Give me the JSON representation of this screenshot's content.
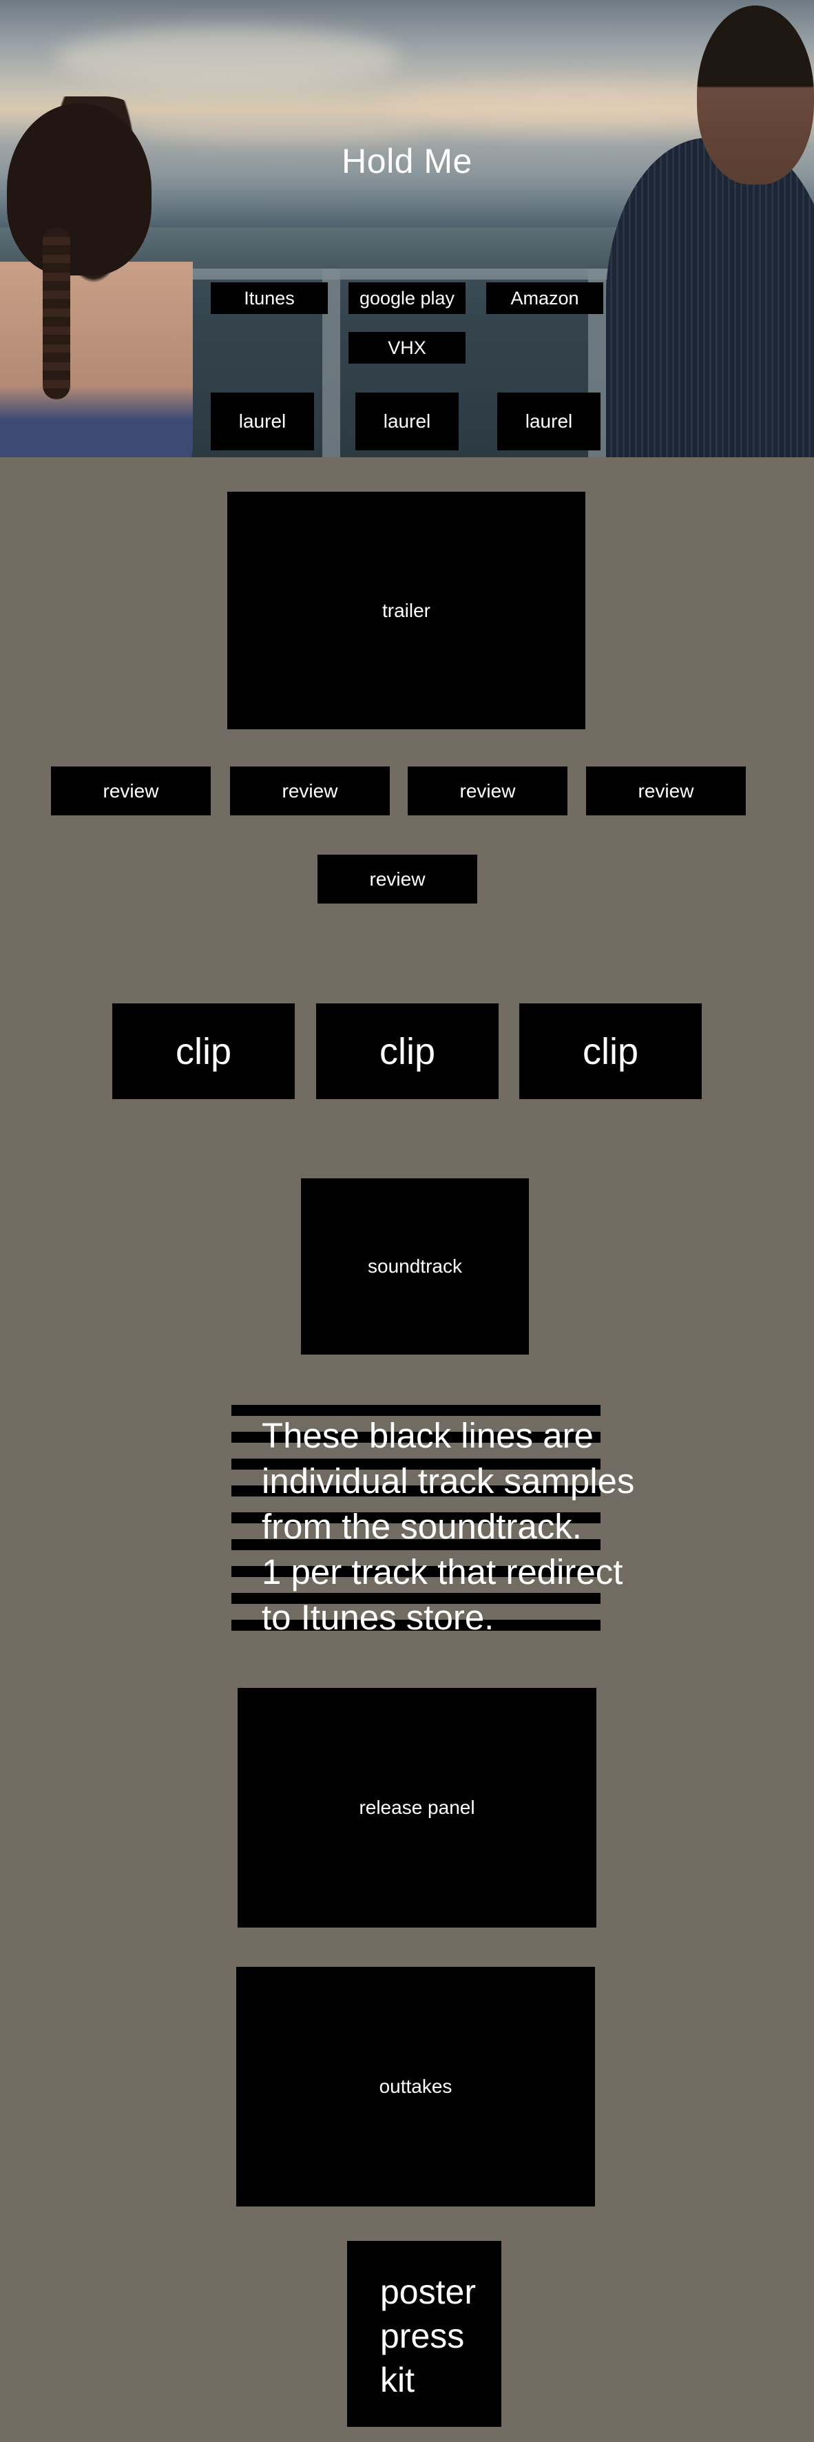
{
  "hero": {
    "title": "Hold Me",
    "buttons": [
      {
        "label": "Itunes"
      },
      {
        "label": "google play"
      },
      {
        "label": "Amazon"
      },
      {
        "label": "VHX"
      }
    ],
    "laurels": [
      "laurel",
      "laurel",
      "laurel"
    ]
  },
  "trailer": {
    "label": "trailer"
  },
  "reviews": [
    "review",
    "review",
    "review",
    "review",
    "review"
  ],
  "clips": [
    "clip",
    "clip",
    "clip"
  ],
  "soundtrack": {
    "label": "soundtrack",
    "note": [
      "These black lines are",
      "individual track samples",
      "from the soundtrack.",
      "1 per track that redirect",
      "to Itunes store."
    ],
    "track_count": 9
  },
  "release_panel": {
    "label": "release panel"
  },
  "outtakes": {
    "label": "outtakes"
  },
  "poster": {
    "lines": [
      "poster",
      "press",
      "kit"
    ]
  },
  "colors": {
    "background": "#716b61",
    "panel": "#000000",
    "text": "#ffffff"
  }
}
